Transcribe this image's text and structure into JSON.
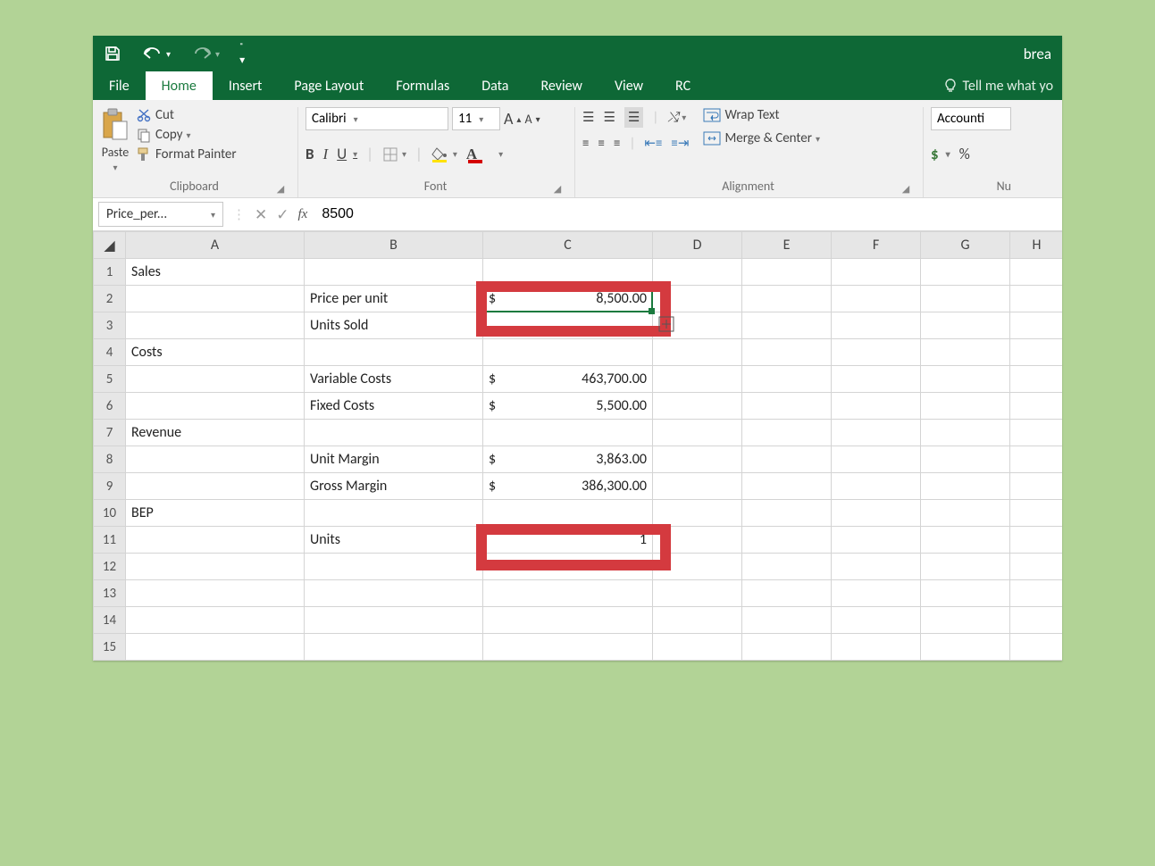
{
  "title_fragment": "brea",
  "quick_access": {
    "save": "save",
    "undo": "undo",
    "redo": "redo"
  },
  "tabs": {
    "file": "File",
    "home": "Home",
    "insert": "Insert",
    "page_layout": "Page Layout",
    "formulas": "Formulas",
    "data": "Data",
    "review": "Review",
    "view": "View",
    "rc": "RC",
    "tellme": "Tell me what yo"
  },
  "ribbon": {
    "clipboard": {
      "paste": "Paste",
      "cut": "Cut",
      "copy": "Copy",
      "format_painter": "Format Painter",
      "label": "Clipboard"
    },
    "font": {
      "name": "Calibri",
      "size": "11",
      "inc": "A",
      "dec": "A",
      "bold": "B",
      "italic": "I",
      "underline": "U",
      "label": "Font"
    },
    "alignment": {
      "wrap": "Wrap Text",
      "merge": "Merge & Center",
      "label": "Alignment"
    },
    "number": {
      "format_truncated": "Accounti",
      "currency": "$",
      "percent": "%",
      "label": "Nu"
    }
  },
  "namebox": "Price_per...",
  "formula_value": "8500",
  "fx_symbol": "fx",
  "columns": [
    "A",
    "B",
    "C",
    "D",
    "E",
    "F",
    "G",
    "H"
  ],
  "rows": [
    {
      "n": "1",
      "A": "Sales",
      "B": "",
      "C": ""
    },
    {
      "n": "2",
      "A": "",
      "B": "Price per unit",
      "C_sym": "$",
      "C_val": "8,500.00",
      "selected": true,
      "highlight": 1
    },
    {
      "n": "3",
      "A": "",
      "B": "Units Sold",
      "C": ""
    },
    {
      "n": "4",
      "A": "Costs",
      "B": "",
      "C": ""
    },
    {
      "n": "5",
      "A": "",
      "B": "Variable Costs",
      "C_sym": "$",
      "C_val": "463,700.00"
    },
    {
      "n": "6",
      "A": "",
      "B": "Fixed Costs",
      "C_sym": "$",
      "C_val": "5,500.00"
    },
    {
      "n": "7",
      "A": "Revenue",
      "B": "",
      "C": ""
    },
    {
      "n": "8",
      "A": "",
      "B": "Unit Margin",
      "C_sym": "$",
      "C_val": "3,863.00"
    },
    {
      "n": "9",
      "A": "",
      "B": "Gross Margin",
      "C_sym": "$",
      "C_val": "386,300.00"
    },
    {
      "n": "10",
      "A": "BEP",
      "B": "",
      "C": ""
    },
    {
      "n": "11",
      "A": "",
      "B": "Units",
      "C_val": "1",
      "highlight": 2
    },
    {
      "n": "12",
      "A": "",
      "B": "",
      "C": ""
    },
    {
      "n": "13",
      "A": "",
      "B": "",
      "C": ""
    },
    {
      "n": "14",
      "A": "",
      "B": "",
      "C": ""
    },
    {
      "n": "15",
      "A": "",
      "B": "",
      "C": ""
    }
  ]
}
